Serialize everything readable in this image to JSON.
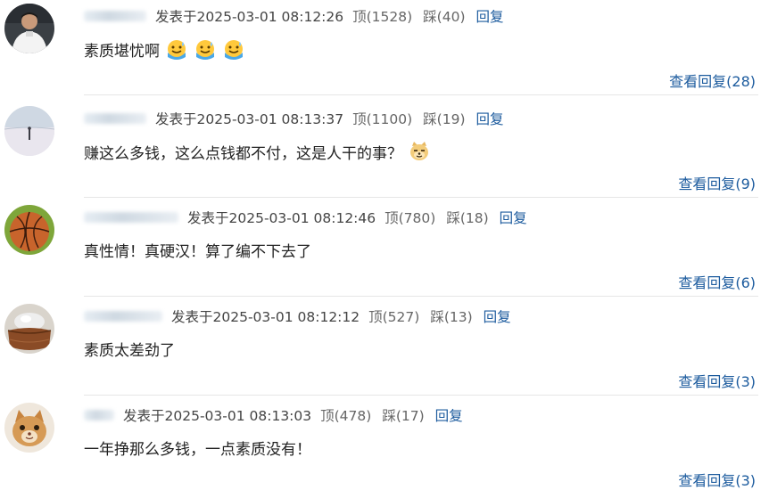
{
  "comments": [
    {
      "username": "",
      "posted": "发表于2025-03-01 08:12:26",
      "likes": "顶(1528)",
      "dislikes": "踩(40)",
      "reply": "回复",
      "text": "素质堪忧啊",
      "view_replies": "查看回复(28)",
      "avatar_icon": "person-in-white-jersey-avatar",
      "emojis": [
        "sweat-smile-emoji",
        "sweat-smile-emoji",
        "sweat-smile-emoji"
      ]
    },
    {
      "username": "",
      "posted": "发表于2025-03-01 08:13:37",
      "likes": "顶(1100)",
      "dislikes": "踩(19)",
      "reply": "回复",
      "text": "赚这么多钱，这么点钱都不付，这是人干的事？",
      "view_replies": "查看回复(9)",
      "avatar_icon": "lone-figure-landscape-avatar",
      "emojis": [
        "doge-emoji"
      ]
    },
    {
      "username": "",
      "posted": "发表于2025-03-01 08:12:46",
      "likes": "顶(780)",
      "dislikes": "踩(18)",
      "reply": "回复",
      "text": "真性情！真硬汉！算了编不下去了",
      "view_replies": "查看回复(6)",
      "avatar_icon": "basketball-avatar",
      "emojis": []
    },
    {
      "username": "",
      "posted": "发表于2025-03-01 08:12:12",
      "likes": "顶(527)",
      "dislikes": "踩(13)",
      "reply": "回复",
      "text": "素质太差劲了",
      "view_replies": "查看回复(3)",
      "avatar_icon": "clay-pot-avatar",
      "emojis": []
    },
    {
      "username": "",
      "posted": "发表于2025-03-01 08:13:03",
      "likes": "顶(478)",
      "dislikes": "踩(17)",
      "reply": "回复",
      "text": "一年挣那么多钱，一点素质没有！",
      "view_replies": "查看回复(3)",
      "avatar_icon": "cat-avatar",
      "emojis": []
    }
  ],
  "colors": {
    "link": "#1c5b9e",
    "meta": "#555555",
    "text": "#222222",
    "divider": "#e6e6e6"
  }
}
